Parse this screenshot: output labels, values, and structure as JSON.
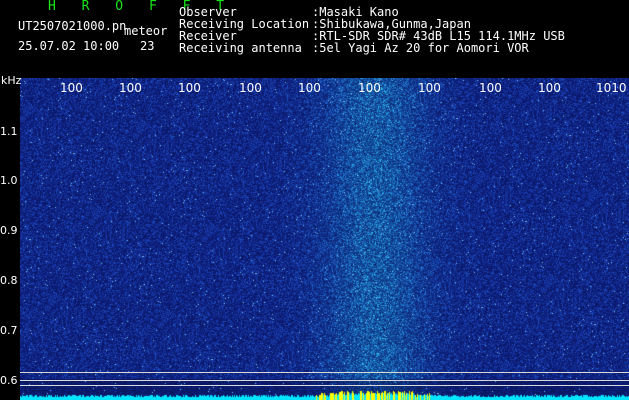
{
  "header": {
    "title": "H R O F F T",
    "filename": "UT2507021000.pn",
    "mode": "meteor",
    "datetime": "25.07.02 10:00",
    "count": "23",
    "observer_label": "Observer",
    "observer_value": ":Masaki Kano",
    "location_label": "Receiving Location",
    "location_value": ":Shibukawa,Gunma,Japan",
    "receiver_label": "Receiver",
    "receiver_value": ":RTL-SDR SDR# 43dB L15 114.1MHz USB",
    "antenna_label": "Receiving antenna",
    "antenna_value": ":5el Yagi Az 20 for Aomori VOR"
  },
  "axis": {
    "unit": "kHz",
    "y_ticks": [
      "1.1",
      "1.0",
      "0.9",
      "0.8",
      "0.7",
      "0.6"
    ],
    "x_ticks": [
      "100",
      "100",
      "100",
      "100",
      "100",
      "100",
      "100",
      "100",
      "100",
      "1010"
    ]
  },
  "colors": {
    "background": "#000000",
    "title": "#19e619",
    "text": "#ffffff",
    "noise": "#1a2aa0",
    "signal": "#4fa8ff",
    "baseline": "#00e5ff",
    "baseline_peak": "#ffff00"
  }
}
